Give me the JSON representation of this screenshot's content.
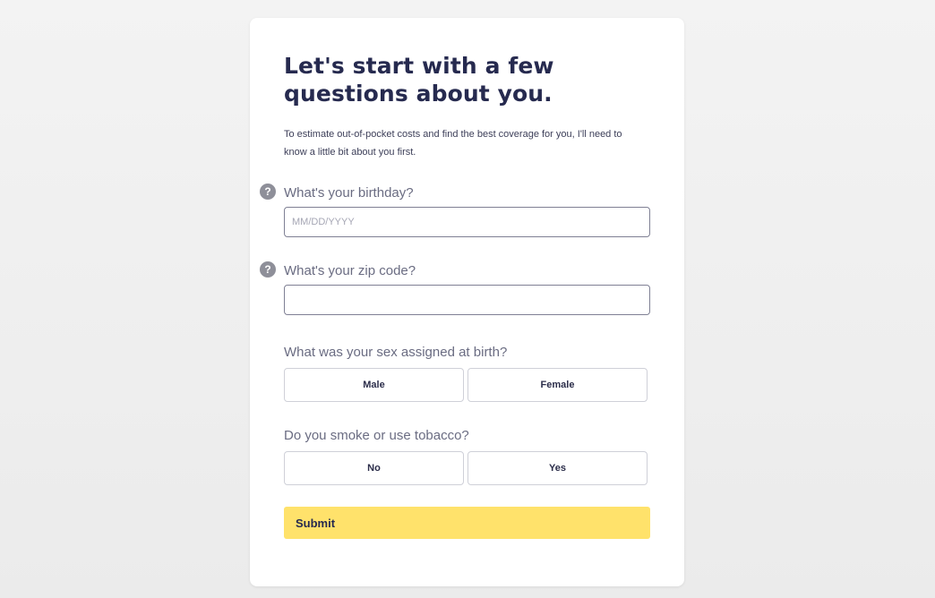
{
  "form": {
    "title": "Let's start with a few questions about you.",
    "subtitle": "To estimate out-of-pocket costs and find the best coverage for you, I'll need to know a little bit about you first.",
    "birthday": {
      "question": "What's your birthday?",
      "placeholder": "MM/DD/YYYY",
      "value": "",
      "help_icon": "question-mark-circle-icon",
      "help_glyph": "?"
    },
    "zip": {
      "question": "What's your zip code?",
      "placeholder": "",
      "value": "",
      "help_icon": "question-mark-circle-icon",
      "help_glyph": "?"
    },
    "sex": {
      "question": "What was your sex assigned at birth?",
      "options": [
        "Male",
        "Female"
      ]
    },
    "tobacco": {
      "question": "Do you smoke or use tobacco?",
      "options": [
        "No",
        "Yes"
      ]
    },
    "submit_label": "Submit"
  },
  "colors": {
    "accent_yellow": "#ffe26b",
    "heading": "#262a4f",
    "background": "#efefef"
  }
}
